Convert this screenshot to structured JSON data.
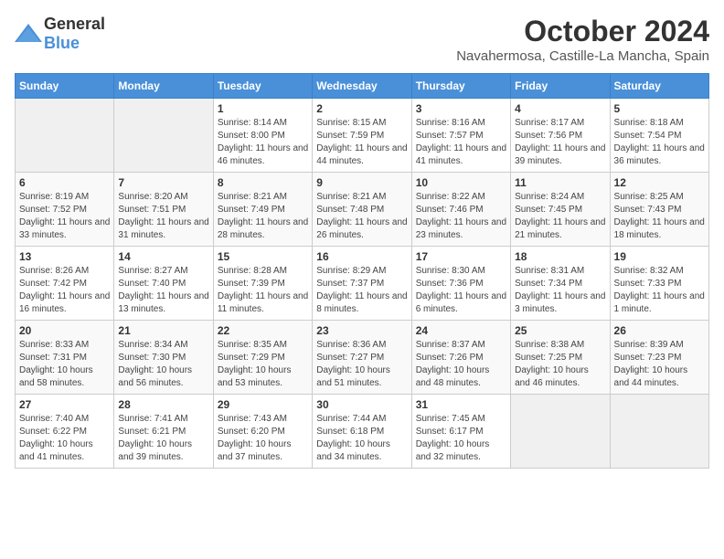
{
  "logo": {
    "general": "General",
    "blue": "Blue"
  },
  "title": "October 2024",
  "subtitle": "Navahermosa, Castille-La Mancha, Spain",
  "weekdays": [
    "Sunday",
    "Monday",
    "Tuesday",
    "Wednesday",
    "Thursday",
    "Friday",
    "Saturday"
  ],
  "weeks": [
    [
      {
        "day": "",
        "info": ""
      },
      {
        "day": "",
        "info": ""
      },
      {
        "day": "1",
        "info": "Sunrise: 8:14 AM\nSunset: 8:00 PM\nDaylight: 11 hours and 46 minutes."
      },
      {
        "day": "2",
        "info": "Sunrise: 8:15 AM\nSunset: 7:59 PM\nDaylight: 11 hours and 44 minutes."
      },
      {
        "day": "3",
        "info": "Sunrise: 8:16 AM\nSunset: 7:57 PM\nDaylight: 11 hours and 41 minutes."
      },
      {
        "day": "4",
        "info": "Sunrise: 8:17 AM\nSunset: 7:56 PM\nDaylight: 11 hours and 39 minutes."
      },
      {
        "day": "5",
        "info": "Sunrise: 8:18 AM\nSunset: 7:54 PM\nDaylight: 11 hours and 36 minutes."
      }
    ],
    [
      {
        "day": "6",
        "info": "Sunrise: 8:19 AM\nSunset: 7:52 PM\nDaylight: 11 hours and 33 minutes."
      },
      {
        "day": "7",
        "info": "Sunrise: 8:20 AM\nSunset: 7:51 PM\nDaylight: 11 hours and 31 minutes."
      },
      {
        "day": "8",
        "info": "Sunrise: 8:21 AM\nSunset: 7:49 PM\nDaylight: 11 hours and 28 minutes."
      },
      {
        "day": "9",
        "info": "Sunrise: 8:21 AM\nSunset: 7:48 PM\nDaylight: 11 hours and 26 minutes."
      },
      {
        "day": "10",
        "info": "Sunrise: 8:22 AM\nSunset: 7:46 PM\nDaylight: 11 hours and 23 minutes."
      },
      {
        "day": "11",
        "info": "Sunrise: 8:24 AM\nSunset: 7:45 PM\nDaylight: 11 hours and 21 minutes."
      },
      {
        "day": "12",
        "info": "Sunrise: 8:25 AM\nSunset: 7:43 PM\nDaylight: 11 hours and 18 minutes."
      }
    ],
    [
      {
        "day": "13",
        "info": "Sunrise: 8:26 AM\nSunset: 7:42 PM\nDaylight: 11 hours and 16 minutes."
      },
      {
        "day": "14",
        "info": "Sunrise: 8:27 AM\nSunset: 7:40 PM\nDaylight: 11 hours and 13 minutes."
      },
      {
        "day": "15",
        "info": "Sunrise: 8:28 AM\nSunset: 7:39 PM\nDaylight: 11 hours and 11 minutes."
      },
      {
        "day": "16",
        "info": "Sunrise: 8:29 AM\nSunset: 7:37 PM\nDaylight: 11 hours and 8 minutes."
      },
      {
        "day": "17",
        "info": "Sunrise: 8:30 AM\nSunset: 7:36 PM\nDaylight: 11 hours and 6 minutes."
      },
      {
        "day": "18",
        "info": "Sunrise: 8:31 AM\nSunset: 7:34 PM\nDaylight: 11 hours and 3 minutes."
      },
      {
        "day": "19",
        "info": "Sunrise: 8:32 AM\nSunset: 7:33 PM\nDaylight: 11 hours and 1 minute."
      }
    ],
    [
      {
        "day": "20",
        "info": "Sunrise: 8:33 AM\nSunset: 7:31 PM\nDaylight: 10 hours and 58 minutes."
      },
      {
        "day": "21",
        "info": "Sunrise: 8:34 AM\nSunset: 7:30 PM\nDaylight: 10 hours and 56 minutes."
      },
      {
        "day": "22",
        "info": "Sunrise: 8:35 AM\nSunset: 7:29 PM\nDaylight: 10 hours and 53 minutes."
      },
      {
        "day": "23",
        "info": "Sunrise: 8:36 AM\nSunset: 7:27 PM\nDaylight: 10 hours and 51 minutes."
      },
      {
        "day": "24",
        "info": "Sunrise: 8:37 AM\nSunset: 7:26 PM\nDaylight: 10 hours and 48 minutes."
      },
      {
        "day": "25",
        "info": "Sunrise: 8:38 AM\nSunset: 7:25 PM\nDaylight: 10 hours and 46 minutes."
      },
      {
        "day": "26",
        "info": "Sunrise: 8:39 AM\nSunset: 7:23 PM\nDaylight: 10 hours and 44 minutes."
      }
    ],
    [
      {
        "day": "27",
        "info": "Sunrise: 7:40 AM\nSunset: 6:22 PM\nDaylight: 10 hours and 41 minutes."
      },
      {
        "day": "28",
        "info": "Sunrise: 7:41 AM\nSunset: 6:21 PM\nDaylight: 10 hours and 39 minutes."
      },
      {
        "day": "29",
        "info": "Sunrise: 7:43 AM\nSunset: 6:20 PM\nDaylight: 10 hours and 37 minutes."
      },
      {
        "day": "30",
        "info": "Sunrise: 7:44 AM\nSunset: 6:18 PM\nDaylight: 10 hours and 34 minutes."
      },
      {
        "day": "31",
        "info": "Sunrise: 7:45 AM\nSunset: 6:17 PM\nDaylight: 10 hours and 32 minutes."
      },
      {
        "day": "",
        "info": ""
      },
      {
        "day": "",
        "info": ""
      }
    ]
  ]
}
